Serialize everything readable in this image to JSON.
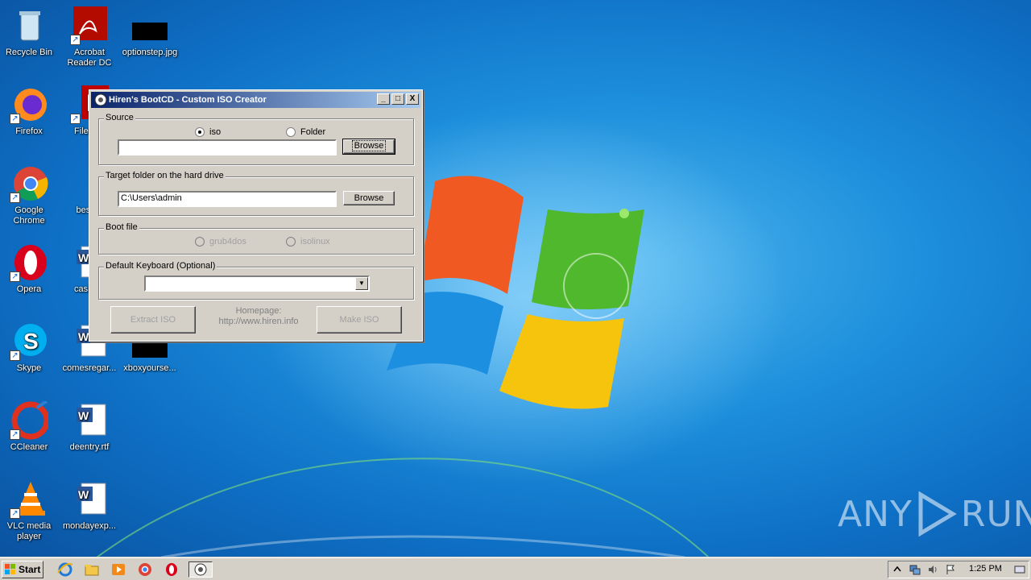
{
  "desktop": {
    "icons": [
      {
        "label": "Recycle Bin"
      },
      {
        "label": "Acrobat Reader DC"
      },
      {
        "label": "optionstep.jpg"
      },
      {
        "label": "Firefox"
      },
      {
        "label": "FileZilla"
      },
      {
        "label": "Google Chrome"
      },
      {
        "label": "bestpo"
      },
      {
        "label": "Opera"
      },
      {
        "label": "cashlea"
      },
      {
        "label": "Skype"
      },
      {
        "label": "comesregar..."
      },
      {
        "label": "xboxyourse..."
      },
      {
        "label": "CCleaner"
      },
      {
        "label": "deentry.rtf"
      },
      {
        "label": "VLC media player"
      },
      {
        "label": "mondayexp..."
      }
    ]
  },
  "dialog": {
    "title": "Hiren's BootCD - Custom ISO Creator",
    "controls": {
      "minimize": "_",
      "maximize": "□",
      "close": "X"
    },
    "source": {
      "label": "Source",
      "option_iso": "iso",
      "option_folder": "Folder",
      "path_value": "",
      "browse_label": "Browse"
    },
    "target": {
      "label": "Target folder on the hard drive",
      "path_value": "C:\\Users\\admin",
      "browse_label": "Browse"
    },
    "boot": {
      "label": "Boot file",
      "option_grub": "grub4dos",
      "option_isolinux": "isolinux"
    },
    "keyboard": {
      "label": "Default Keyboard (Optional)",
      "selected": ""
    },
    "footer": {
      "extract_label": "Extract ISO",
      "homepage_label": "Homepage:",
      "homepage_url": "http://www.hiren.info",
      "make_label": "Make ISO"
    }
  },
  "watermark": {
    "text_left": "ANY",
    "text_right": "RUN"
  },
  "taskbar": {
    "start_label": "Start",
    "clock": "1:25 PM"
  },
  "colors": {
    "titlebar_start": "#0a246a",
    "titlebar_end": "#a6caf0",
    "face": "#d4d0c8"
  }
}
